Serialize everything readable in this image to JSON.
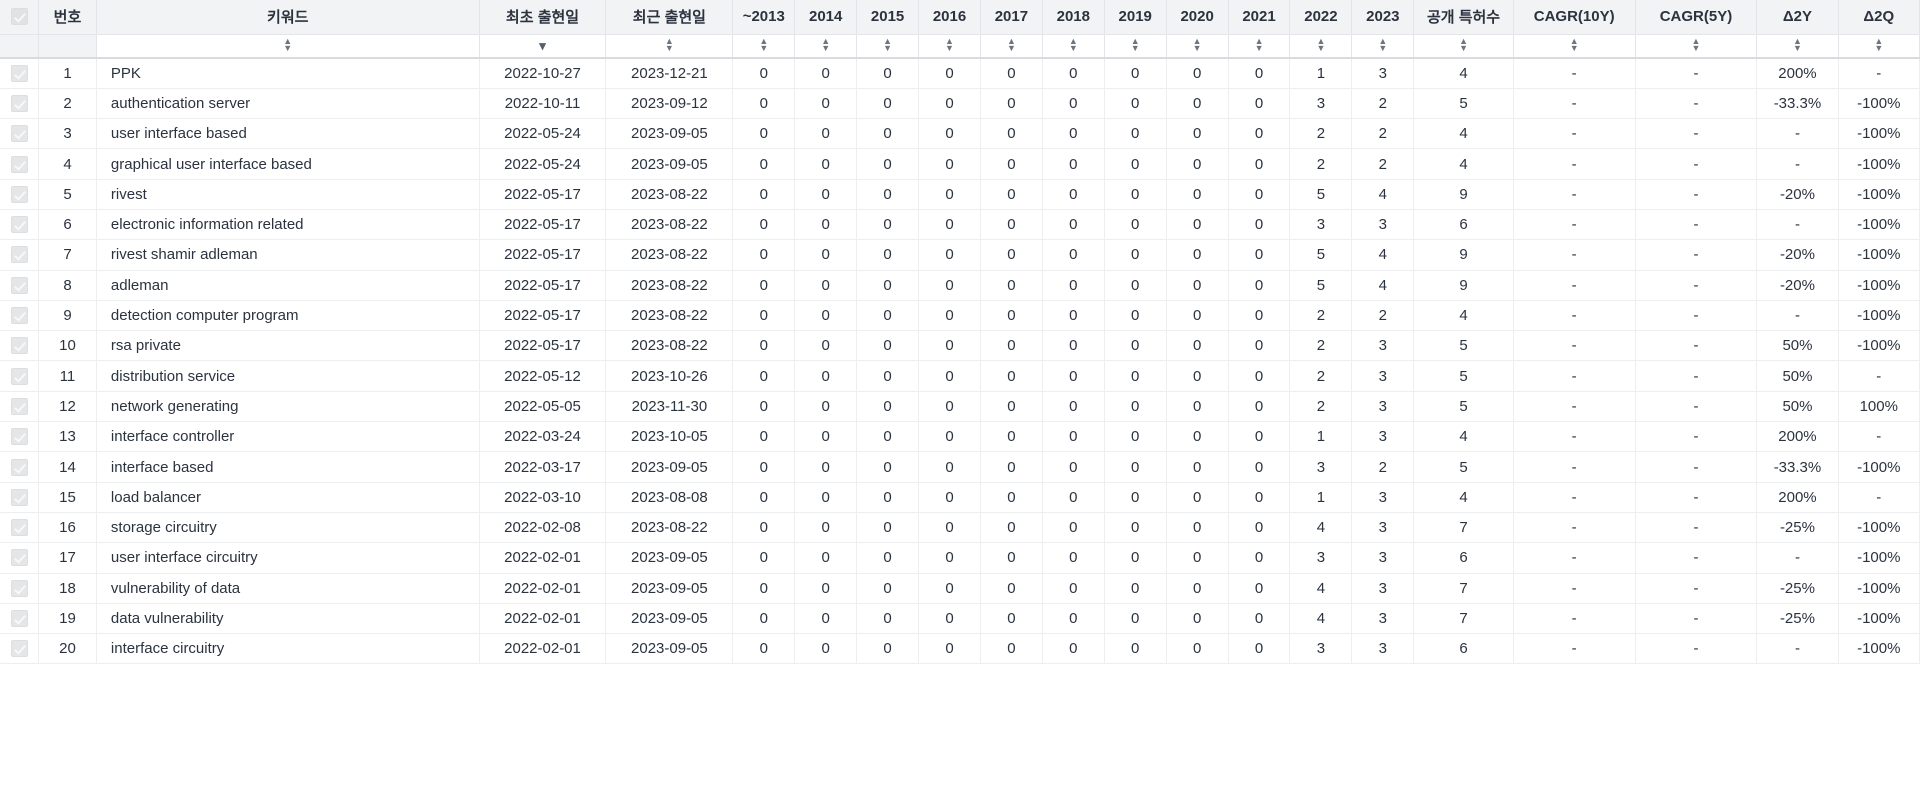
{
  "table": {
    "columns": [
      {
        "key": "check",
        "label": "",
        "type": "check",
        "sort": "none",
        "width_class": "w-check"
      },
      {
        "key": "no",
        "label": "번호",
        "type": "num",
        "sort": "none",
        "width_class": "w-no"
      },
      {
        "key": "keyword",
        "label": "키워드",
        "type": "text",
        "sort": "both",
        "width_class": "w-keyword"
      },
      {
        "key": "first",
        "label": "최초 출현일",
        "type": "date",
        "sort": "desc",
        "width_class": "w-date"
      },
      {
        "key": "recent",
        "label": "최근 출현일",
        "type": "date",
        "sort": "both",
        "width_class": "w-date"
      },
      {
        "key": "y2013",
        "label": "~2013",
        "type": "num",
        "sort": "both",
        "width_class": "w-year"
      },
      {
        "key": "y2014",
        "label": "2014",
        "type": "num",
        "sort": "both",
        "width_class": "w-year"
      },
      {
        "key": "y2015",
        "label": "2015",
        "type": "num",
        "sort": "both",
        "width_class": "w-year"
      },
      {
        "key": "y2016",
        "label": "2016",
        "type": "num",
        "sort": "both",
        "width_class": "w-year"
      },
      {
        "key": "y2017",
        "label": "2017",
        "type": "num",
        "sort": "both",
        "width_class": "w-year"
      },
      {
        "key": "y2018",
        "label": "2018",
        "type": "num",
        "sort": "both",
        "width_class": "w-year"
      },
      {
        "key": "y2019",
        "label": "2019",
        "type": "num",
        "sort": "both",
        "width_class": "w-year"
      },
      {
        "key": "y2020",
        "label": "2020",
        "type": "num",
        "sort": "both",
        "width_class": "w-year"
      },
      {
        "key": "y2021",
        "label": "2021",
        "type": "num",
        "sort": "both",
        "width_class": "w-year"
      },
      {
        "key": "y2022",
        "label": "2022",
        "type": "num",
        "sort": "both",
        "width_class": "w-year"
      },
      {
        "key": "y2023",
        "label": "2023",
        "type": "num",
        "sort": "both",
        "width_class": "w-year"
      },
      {
        "key": "total",
        "label": "공개 특허수",
        "type": "num",
        "sort": "both",
        "width_class": "w-count"
      },
      {
        "key": "cagr10",
        "label": "CAGR(10Y)",
        "type": "pct",
        "sort": "both",
        "width_class": "w-cagr"
      },
      {
        "key": "cagr5",
        "label": "CAGR(5Y)",
        "type": "pct",
        "sort": "both",
        "width_class": "w-cagr"
      },
      {
        "key": "d2y",
        "label": "Δ2Y",
        "type": "pct",
        "sort": "both",
        "width_class": "w-delta"
      },
      {
        "key": "d2q",
        "label": "Δ2Q",
        "type": "pct",
        "sort": "both",
        "width_class": "w-delta"
      }
    ],
    "header_select_all_checked": true,
    "rows": [
      {
        "checked": true,
        "no": "1",
        "keyword": "PPK",
        "first": "2022-10-27",
        "recent": "2023-12-21",
        "y2013": "0",
        "y2014": "0",
        "y2015": "0",
        "y2016": "0",
        "y2017": "0",
        "y2018": "0",
        "y2019": "0",
        "y2020": "0",
        "y2021": "0",
        "y2022": "1",
        "y2023": "3",
        "total": "4",
        "cagr10": "-",
        "cagr5": "-",
        "d2y": "200%",
        "d2q": "-"
      },
      {
        "checked": true,
        "no": "2",
        "keyword": "authentication server",
        "first": "2022-10-11",
        "recent": "2023-09-12",
        "y2013": "0",
        "y2014": "0",
        "y2015": "0",
        "y2016": "0",
        "y2017": "0",
        "y2018": "0",
        "y2019": "0",
        "y2020": "0",
        "y2021": "0",
        "y2022": "3",
        "y2023": "2",
        "total": "5",
        "cagr10": "-",
        "cagr5": "-",
        "d2y": "-33.3%",
        "d2q": "-100%"
      },
      {
        "checked": true,
        "no": "3",
        "keyword": "user interface based",
        "first": "2022-05-24",
        "recent": "2023-09-05",
        "y2013": "0",
        "y2014": "0",
        "y2015": "0",
        "y2016": "0",
        "y2017": "0",
        "y2018": "0",
        "y2019": "0",
        "y2020": "0",
        "y2021": "0",
        "y2022": "2",
        "y2023": "2",
        "total": "4",
        "cagr10": "-",
        "cagr5": "-",
        "d2y": "-",
        "d2q": "-100%"
      },
      {
        "checked": true,
        "no": "4",
        "keyword": "graphical user interface based",
        "first": "2022-05-24",
        "recent": "2023-09-05",
        "y2013": "0",
        "y2014": "0",
        "y2015": "0",
        "y2016": "0",
        "y2017": "0",
        "y2018": "0",
        "y2019": "0",
        "y2020": "0",
        "y2021": "0",
        "y2022": "2",
        "y2023": "2",
        "total": "4",
        "cagr10": "-",
        "cagr5": "-",
        "d2y": "-",
        "d2q": "-100%"
      },
      {
        "checked": true,
        "no": "5",
        "keyword": "rivest",
        "first": "2022-05-17",
        "recent": "2023-08-22",
        "y2013": "0",
        "y2014": "0",
        "y2015": "0",
        "y2016": "0",
        "y2017": "0",
        "y2018": "0",
        "y2019": "0",
        "y2020": "0",
        "y2021": "0",
        "y2022": "5",
        "y2023": "4",
        "total": "9",
        "cagr10": "-",
        "cagr5": "-",
        "d2y": "-20%",
        "d2q": "-100%"
      },
      {
        "checked": true,
        "no": "6",
        "keyword": "electronic information related",
        "first": "2022-05-17",
        "recent": "2023-08-22",
        "y2013": "0",
        "y2014": "0",
        "y2015": "0",
        "y2016": "0",
        "y2017": "0",
        "y2018": "0",
        "y2019": "0",
        "y2020": "0",
        "y2021": "0",
        "y2022": "3",
        "y2023": "3",
        "total": "6",
        "cagr10": "-",
        "cagr5": "-",
        "d2y": "-",
        "d2q": "-100%"
      },
      {
        "checked": true,
        "no": "7",
        "keyword": "rivest shamir adleman",
        "first": "2022-05-17",
        "recent": "2023-08-22",
        "y2013": "0",
        "y2014": "0",
        "y2015": "0",
        "y2016": "0",
        "y2017": "0",
        "y2018": "0",
        "y2019": "0",
        "y2020": "0",
        "y2021": "0",
        "y2022": "5",
        "y2023": "4",
        "total": "9",
        "cagr10": "-",
        "cagr5": "-",
        "d2y": "-20%",
        "d2q": "-100%"
      },
      {
        "checked": true,
        "no": "8",
        "keyword": "adleman",
        "first": "2022-05-17",
        "recent": "2023-08-22",
        "y2013": "0",
        "y2014": "0",
        "y2015": "0",
        "y2016": "0",
        "y2017": "0",
        "y2018": "0",
        "y2019": "0",
        "y2020": "0",
        "y2021": "0",
        "y2022": "5",
        "y2023": "4",
        "total": "9",
        "cagr10": "-",
        "cagr5": "-",
        "d2y": "-20%",
        "d2q": "-100%"
      },
      {
        "checked": true,
        "no": "9",
        "keyword": "detection computer program",
        "first": "2022-05-17",
        "recent": "2023-08-22",
        "y2013": "0",
        "y2014": "0",
        "y2015": "0",
        "y2016": "0",
        "y2017": "0",
        "y2018": "0",
        "y2019": "0",
        "y2020": "0",
        "y2021": "0",
        "y2022": "2",
        "y2023": "2",
        "total": "4",
        "cagr10": "-",
        "cagr5": "-",
        "d2y": "-",
        "d2q": "-100%"
      },
      {
        "checked": true,
        "no": "10",
        "keyword": "rsa private",
        "first": "2022-05-17",
        "recent": "2023-08-22",
        "y2013": "0",
        "y2014": "0",
        "y2015": "0",
        "y2016": "0",
        "y2017": "0",
        "y2018": "0",
        "y2019": "0",
        "y2020": "0",
        "y2021": "0",
        "y2022": "2",
        "y2023": "3",
        "total": "5",
        "cagr10": "-",
        "cagr5": "-",
        "d2y": "50%",
        "d2q": "-100%"
      },
      {
        "checked": true,
        "no": "11",
        "keyword": "distribution service",
        "first": "2022-05-12",
        "recent": "2023-10-26",
        "y2013": "0",
        "y2014": "0",
        "y2015": "0",
        "y2016": "0",
        "y2017": "0",
        "y2018": "0",
        "y2019": "0",
        "y2020": "0",
        "y2021": "0",
        "y2022": "2",
        "y2023": "3",
        "total": "5",
        "cagr10": "-",
        "cagr5": "-",
        "d2y": "50%",
        "d2q": "-"
      },
      {
        "checked": true,
        "no": "12",
        "keyword": "network generating",
        "first": "2022-05-05",
        "recent": "2023-11-30",
        "y2013": "0",
        "y2014": "0",
        "y2015": "0",
        "y2016": "0",
        "y2017": "0",
        "y2018": "0",
        "y2019": "0",
        "y2020": "0",
        "y2021": "0",
        "y2022": "2",
        "y2023": "3",
        "total": "5",
        "cagr10": "-",
        "cagr5": "-",
        "d2y": "50%",
        "d2q": "100%"
      },
      {
        "checked": true,
        "no": "13",
        "keyword": "interface controller",
        "first": "2022-03-24",
        "recent": "2023-10-05",
        "y2013": "0",
        "y2014": "0",
        "y2015": "0",
        "y2016": "0",
        "y2017": "0",
        "y2018": "0",
        "y2019": "0",
        "y2020": "0",
        "y2021": "0",
        "y2022": "1",
        "y2023": "3",
        "total": "4",
        "cagr10": "-",
        "cagr5": "-",
        "d2y": "200%",
        "d2q": "-"
      },
      {
        "checked": true,
        "no": "14",
        "keyword": "interface based",
        "first": "2022-03-17",
        "recent": "2023-09-05",
        "y2013": "0",
        "y2014": "0",
        "y2015": "0",
        "y2016": "0",
        "y2017": "0",
        "y2018": "0",
        "y2019": "0",
        "y2020": "0",
        "y2021": "0",
        "y2022": "3",
        "y2023": "2",
        "total": "5",
        "cagr10": "-",
        "cagr5": "-",
        "d2y": "-33.3%",
        "d2q": "-100%"
      },
      {
        "checked": true,
        "no": "15",
        "keyword": "load balancer",
        "first": "2022-03-10",
        "recent": "2023-08-08",
        "y2013": "0",
        "y2014": "0",
        "y2015": "0",
        "y2016": "0",
        "y2017": "0",
        "y2018": "0",
        "y2019": "0",
        "y2020": "0",
        "y2021": "0",
        "y2022": "1",
        "y2023": "3",
        "total": "4",
        "cagr10": "-",
        "cagr5": "-",
        "d2y": "200%",
        "d2q": "-"
      },
      {
        "checked": true,
        "no": "16",
        "keyword": "storage circuitry",
        "first": "2022-02-08",
        "recent": "2023-08-22",
        "y2013": "0",
        "y2014": "0",
        "y2015": "0",
        "y2016": "0",
        "y2017": "0",
        "y2018": "0",
        "y2019": "0",
        "y2020": "0",
        "y2021": "0",
        "y2022": "4",
        "y2023": "3",
        "total": "7",
        "cagr10": "-",
        "cagr5": "-",
        "d2y": "-25%",
        "d2q": "-100%"
      },
      {
        "checked": true,
        "no": "17",
        "keyword": "user interface circuitry",
        "first": "2022-02-01",
        "recent": "2023-09-05",
        "y2013": "0",
        "y2014": "0",
        "y2015": "0",
        "y2016": "0",
        "y2017": "0",
        "y2018": "0",
        "y2019": "0",
        "y2020": "0",
        "y2021": "0",
        "y2022": "3",
        "y2023": "3",
        "total": "6",
        "cagr10": "-",
        "cagr5": "-",
        "d2y": "-",
        "d2q": "-100%"
      },
      {
        "checked": true,
        "no": "18",
        "keyword": "vulnerability of data",
        "first": "2022-02-01",
        "recent": "2023-09-05",
        "y2013": "0",
        "y2014": "0",
        "y2015": "0",
        "y2016": "0",
        "y2017": "0",
        "y2018": "0",
        "y2019": "0",
        "y2020": "0",
        "y2021": "0",
        "y2022": "4",
        "y2023": "3",
        "total": "7",
        "cagr10": "-",
        "cagr5": "-",
        "d2y": "-25%",
        "d2q": "-100%"
      },
      {
        "checked": true,
        "no": "19",
        "keyword": "data vulnerability",
        "first": "2022-02-01",
        "recent": "2023-09-05",
        "y2013": "0",
        "y2014": "0",
        "y2015": "0",
        "y2016": "0",
        "y2017": "0",
        "y2018": "0",
        "y2019": "0",
        "y2020": "0",
        "y2021": "0",
        "y2022": "4",
        "y2023": "3",
        "total": "7",
        "cagr10": "-",
        "cagr5": "-",
        "d2y": "-25%",
        "d2q": "-100%"
      },
      {
        "checked": true,
        "no": "20",
        "keyword": "interface circuitry",
        "first": "2022-02-01",
        "recent": "2023-09-05",
        "y2013": "0",
        "y2014": "0",
        "y2015": "0",
        "y2016": "0",
        "y2017": "0",
        "y2018": "0",
        "y2019": "0",
        "y2020": "0",
        "y2021": "0",
        "y2022": "3",
        "y2023": "3",
        "total": "6",
        "cagr10": "-",
        "cagr5": "-",
        "d2y": "-",
        "d2q": "-100%"
      }
    ]
  },
  "icons": {
    "sort_both": "sort-both-icon",
    "sort_desc": "sort-descending-icon",
    "checkbox_checked": "checkbox-checked-icon"
  },
  "colors": {
    "header_bg": "#f2f3f5",
    "grid_line": "#eceef0",
    "text": "#2b333f",
    "checkbox_fill": "#e4e6e8"
  }
}
